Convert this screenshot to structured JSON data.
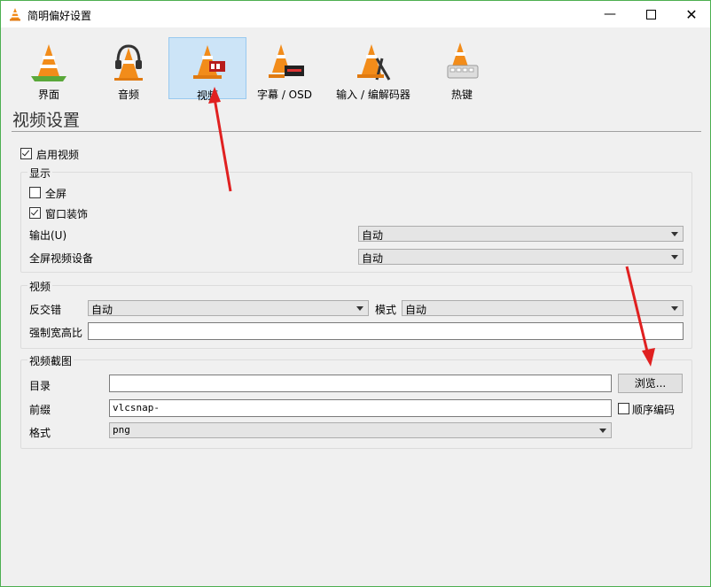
{
  "window": {
    "title": "简明偏好设置"
  },
  "toolbar": {
    "items": [
      {
        "label": "界面"
      },
      {
        "label": "音频"
      },
      {
        "label": "视频",
        "selected": true
      },
      {
        "label": "字幕 / OSD"
      },
      {
        "label": "输入 / 编解码器"
      },
      {
        "label": "热键"
      }
    ]
  },
  "page": {
    "title": "视频设置"
  },
  "enable_video": {
    "label": "启用视频",
    "checked": true
  },
  "display": {
    "title": "显示",
    "fullscreen": {
      "label": "全屏",
      "checked": false
    },
    "window_decorations": {
      "label": "窗口装饰",
      "checked": true
    },
    "output": {
      "label": "输出(U)",
      "value": "自动"
    },
    "fullscreen_device": {
      "label": "全屏视频设备",
      "value": "自动"
    }
  },
  "video": {
    "title": "视频",
    "deinterlace": {
      "label": "反交错",
      "value": "自动"
    },
    "mode": {
      "label": "模式",
      "value": "自动"
    },
    "aspect_ratio": {
      "label": "强制宽高比",
      "value": ""
    }
  },
  "snapshot": {
    "title": "视频截图",
    "directory": {
      "label": "目录",
      "value": ""
    },
    "browse_label": "浏览...",
    "prefix": {
      "label": "前缀",
      "value": "vlcsnap-"
    },
    "sequential": {
      "label": "顺序编码",
      "checked": false
    },
    "format": {
      "label": "格式",
      "value": "png"
    }
  },
  "colors": {
    "accent_arrow": "#e02020",
    "selection": "#cce4f7"
  }
}
